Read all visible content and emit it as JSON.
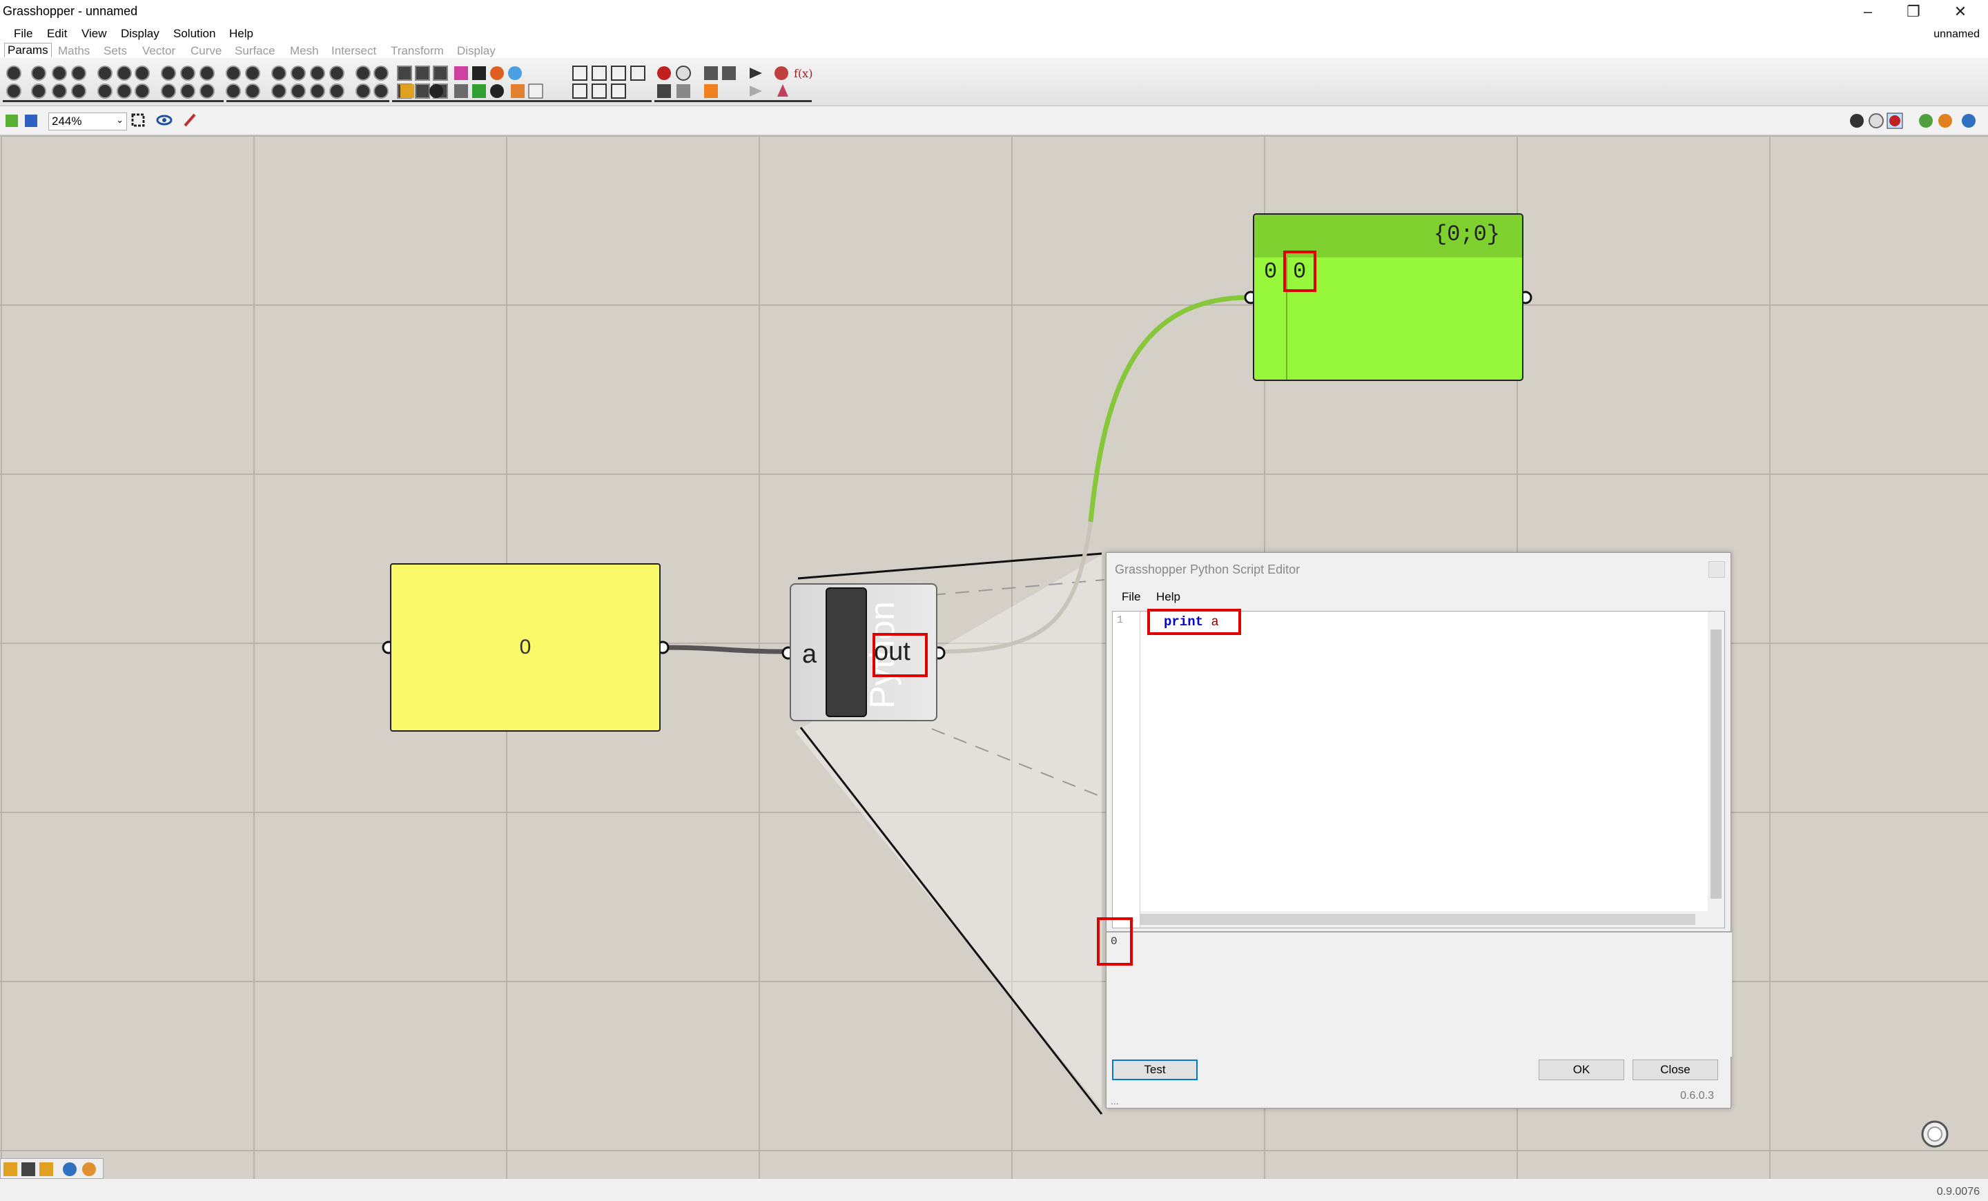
{
  "window": {
    "title": "Grasshopper - unnamed",
    "doc_name": "unnamed",
    "min_icon": "minimize-icon",
    "restore_icon": "restore-icon",
    "close_icon": "close-icon"
  },
  "menu": [
    "File",
    "Edit",
    "View",
    "Display",
    "Solution",
    "Help"
  ],
  "tabs": [
    "Params",
    "Maths",
    "Sets",
    "Vector",
    "Curve",
    "Surface",
    "Mesh",
    "Intersect",
    "Transform",
    "Display"
  ],
  "toolbar": {
    "zoom": "244%"
  },
  "canvas": {
    "number_slider": {
      "value": "0"
    },
    "python_component": {
      "title": "Python",
      "input": "a",
      "output": "out"
    },
    "panel": {
      "path": "{0;0}",
      "index": "0",
      "value": "0"
    }
  },
  "editor": {
    "title": "Grasshopper Python Script Editor",
    "menu": [
      "File",
      "Help"
    ],
    "line_number": "1",
    "code_keyword": "print",
    "code_arg": "a",
    "output": "0",
    "buttons": {
      "test": "Test",
      "ok": "OK",
      "close": "Close"
    },
    "version": "0.6.0.3",
    "dots": "..."
  },
  "status": {
    "version": "0.9.0076"
  }
}
